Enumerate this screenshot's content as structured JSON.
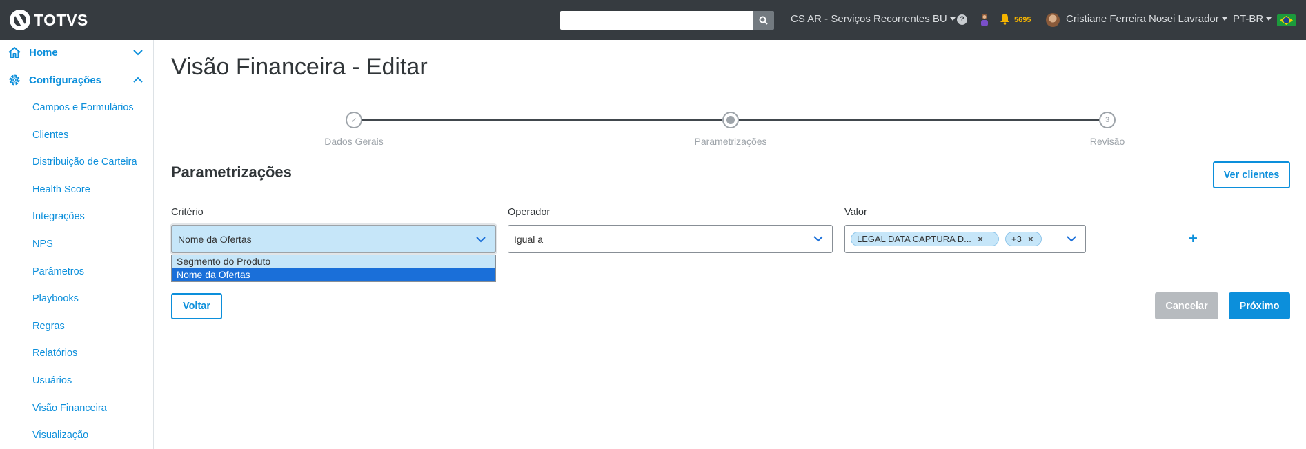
{
  "header": {
    "logo_text": "TOTVS",
    "search": {
      "value": "",
      "placeholder": ""
    },
    "company_selector": "CS AR - Serviços Recorrentes BU",
    "help_icon": "question-circle-icon",
    "notification_count": "5695",
    "user_name": "Cristiane Ferreira Nosei Lavrador",
    "language": "PT-BR",
    "colors": {
      "background": "#363b40",
      "notification": "#f5b400"
    }
  },
  "sidebar": {
    "items": [
      {
        "label": "Home",
        "icon": "home-icon",
        "expanded": false
      },
      {
        "label": "Configurações",
        "icon": "gear-icon",
        "expanded": true
      }
    ],
    "subitems": [
      "Campos e Formulários",
      "Clientes",
      "Distribuição de Carteira",
      "Health Score",
      "Integrações",
      "NPS",
      "Parâmetros",
      "Playbooks",
      "Regras",
      "Relatórios",
      "Usuários",
      "Visão Financeira",
      "Visualização"
    ],
    "accent_color": "#0c8fdb"
  },
  "page": {
    "title": "Visão Financeira - Editar",
    "steps": [
      {
        "label": "Dados Gerais",
        "state": "done",
        "marker": "✓"
      },
      {
        "label": "Parametrizações",
        "state": "active",
        "marker": ""
      },
      {
        "label": "Revisão",
        "state": "pending",
        "marker": "3"
      }
    ],
    "section_title": "Parametrizações",
    "ver_clientes_label": "Ver clientes",
    "fields": {
      "criterio": {
        "label": "Critério",
        "value": "Nome da Ofertas",
        "options": [
          "Segmento do Produto",
          "Nome da Ofertas"
        ],
        "selected_option": "Nome da Ofertas"
      },
      "operador": {
        "label": "Operador",
        "value": "Igual a"
      },
      "valor": {
        "label": "Valor",
        "chips": [
          "LEGAL DATA CAPTURA D...",
          "+3"
        ]
      }
    },
    "add_label": "+",
    "buttons": {
      "back": "Voltar",
      "cancel": "Cancelar",
      "next": "Próximo"
    }
  }
}
